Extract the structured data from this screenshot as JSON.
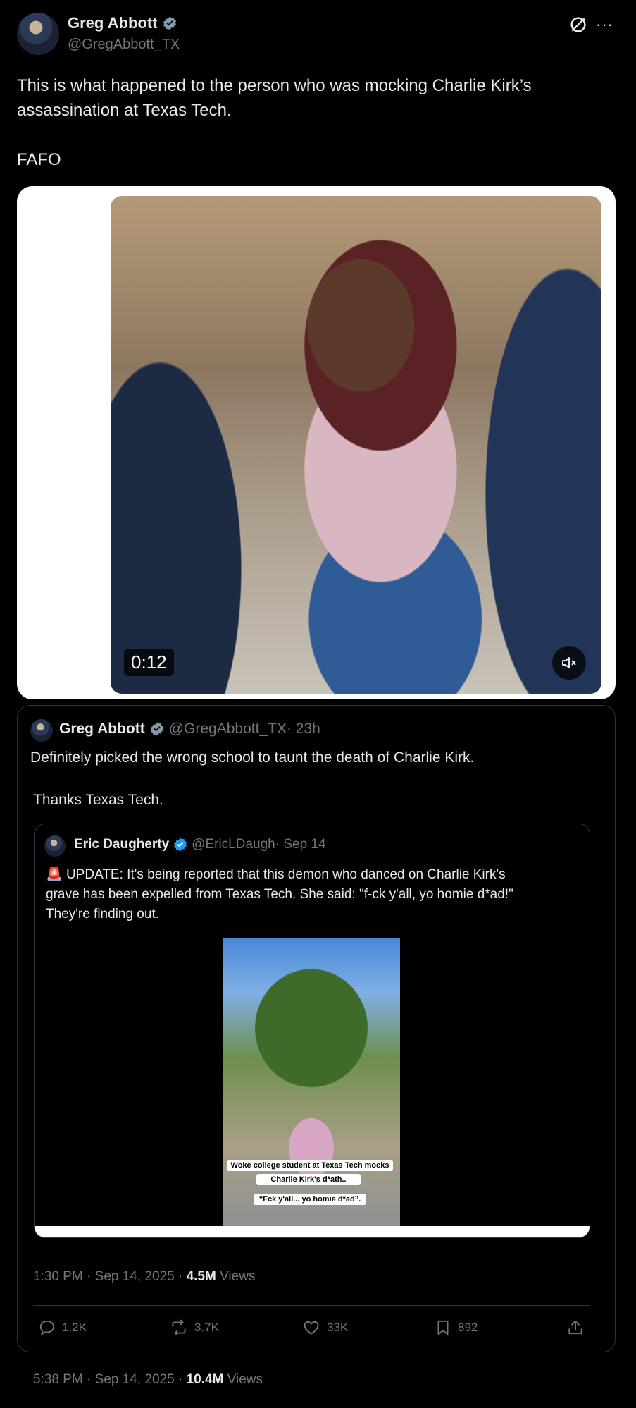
{
  "header": {
    "author_name": "Greg Abbott",
    "author_handle": "@GregAbbott_TX"
  },
  "post": {
    "text_line1": "This is what happened to the person who was mocking Charlie Kirk’s",
    "text_line2": "assassination at Texas Tech.",
    "text_line3": "FAFO",
    "video_time": "0:12",
    "timestamp": "5:38 PM · Sep 14, 2025 · ",
    "views_count": "10.4M",
    "views_label": " Views"
  },
  "quoted": {
    "author_name": "Greg Abbott",
    "author_handle": "@GregAbbott_TX",
    "time": " · 23h",
    "text_line1": "Definitely picked the wrong school to taunt the death of Charlie Kirk.",
    "text_line2": "Thanks Texas Tech.",
    "timestamp": "1:30 PM · Sep 14, 2025 · ",
    "views_count": "4.5M",
    "views_label": " Views",
    "actions": {
      "replies": "1.2K",
      "reposts": "3.7K",
      "likes": "33K",
      "bookmarks": "892"
    }
  },
  "nested": {
    "author_name": "Eric Daugherty",
    "author_handle": "@EricLDaugh",
    "time": " · Sep 14",
    "emoji": "🚨",
    "text_line1": " UPDATE: It's being reported that this demon who danced on Charlie Kirk's",
    "text_line2": "grave has been expelled from Texas Tech. She said: \"f-ck y'all, yo homie d*ad!\"",
    "text_line3": "They're finding out.",
    "caption1": "Woke college student at Texas Tech mocks",
    "caption2": "Charlie Kirk's d*ath..",
    "caption3": "“Fck y'all... yo homie d*ad”."
  },
  "colors": {
    "background": "#000000",
    "text": "#e7e9ea",
    "muted": "#71767b",
    "verified_blue": "#1d9bf0",
    "verified_gray": "#829aab",
    "border": "#2f3336"
  },
  "icons": [
    "grok-icon",
    "more-icon",
    "verified-badge-icon",
    "mute-icon",
    "reply-icon",
    "repost-icon",
    "like-icon",
    "bookmark-icon",
    "share-icon"
  ]
}
